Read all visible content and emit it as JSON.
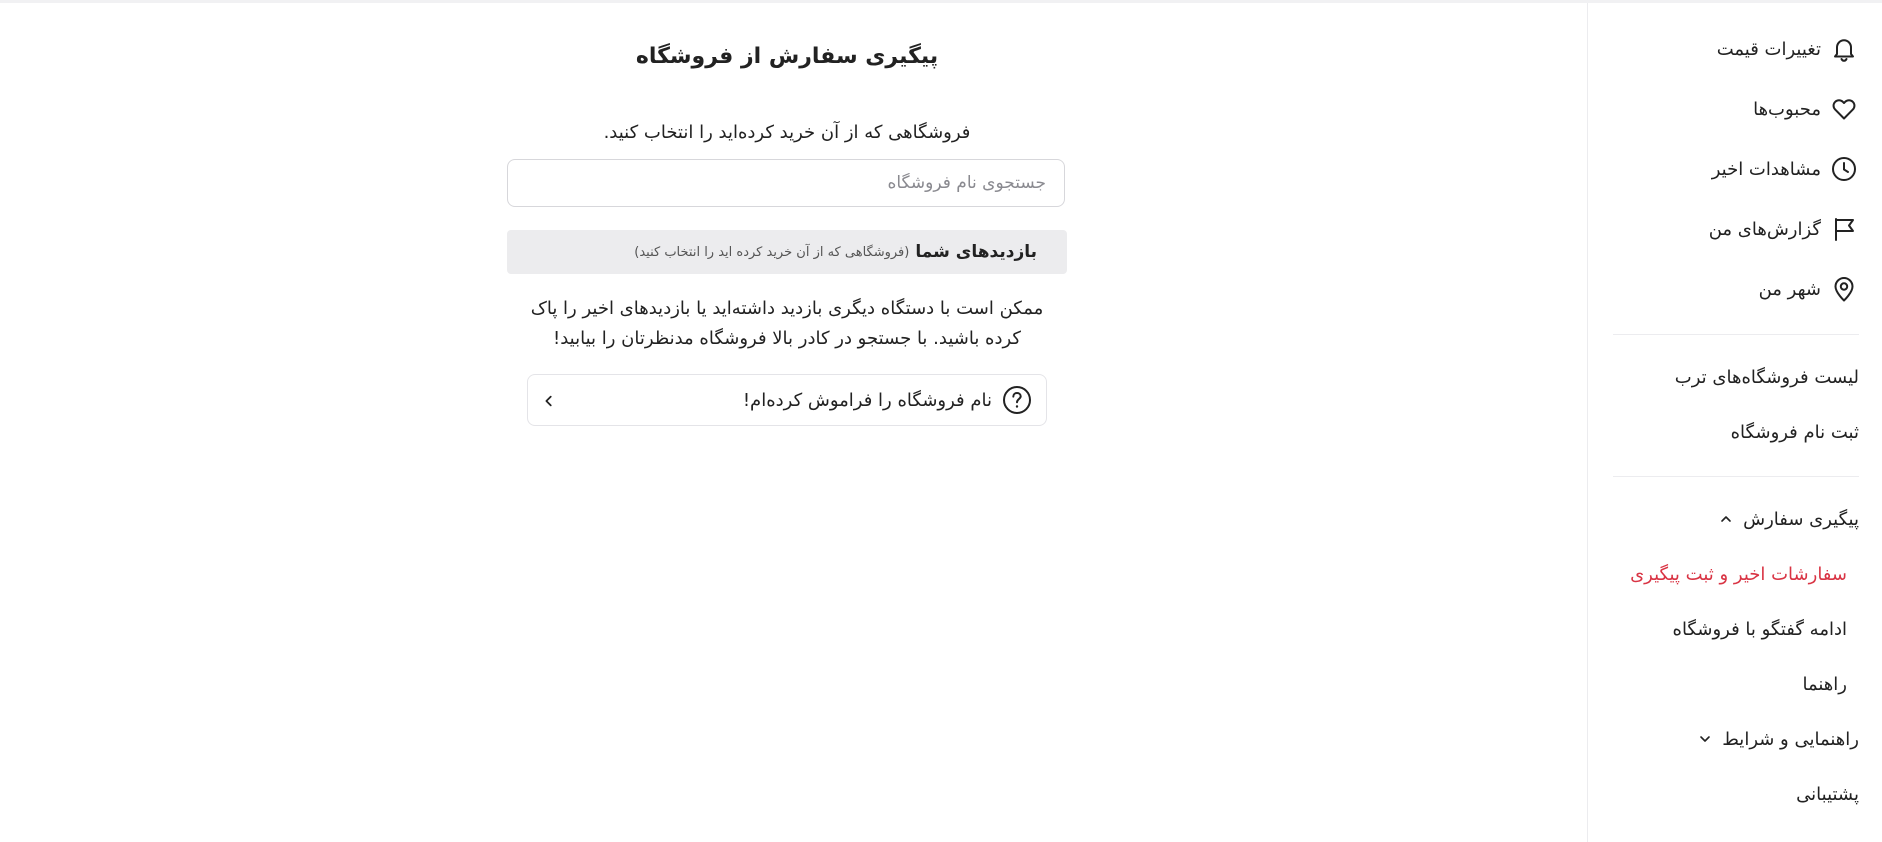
{
  "sidebar": {
    "icon_items": [
      {
        "label": "تغییرات قیمت",
        "icon": "bell-icon"
      },
      {
        "label": "محبوب‌ها",
        "icon": "heart-icon"
      },
      {
        "label": "مشاهدات اخیر",
        "icon": "clock-icon"
      },
      {
        "label": "گزارش‌های من",
        "icon": "flag-icon"
      },
      {
        "label": "شهر من",
        "icon": "location-pin-icon"
      }
    ],
    "links": {
      "stores_list": "لیست فروشگاه‌های ترب",
      "store_register": "ثبت نام فروشگاه",
      "order_tracking": "پیگیری سفارش",
      "recent_orders": "سفارشات اخیر و ثبت پیگیری",
      "continue_chat": "ادامه گفتگو با فروشگاه",
      "guide": "راهنما",
      "terms": "راهنمایی و شرایط",
      "support": "پشتیبانی"
    },
    "active_color": "#d93444"
  },
  "main": {
    "title": "پیگیری سفارش از فروشگاه",
    "instruction": "فروشگاهی که از آن خرید کرده‌اید را انتخاب کنید.",
    "search": {
      "placeholder": "جستجوی نام فروشگاه",
      "value": ""
    },
    "visits": {
      "title": "بازدیدهای شما",
      "hint": "(فروشگاهی که از آن خرید کرده اید را انتخاب کنید)"
    },
    "note": "ممکن است با دستگاه دیگری بازدید داشته‌اید یا بازدیدهای اخیر را پاک کرده باشید. با جستجو در کادر بالا فروشگاه مدنظرتان را بیابید!",
    "forgot_button": "نام فروشگاه را فراموش کرده‌ام!"
  }
}
